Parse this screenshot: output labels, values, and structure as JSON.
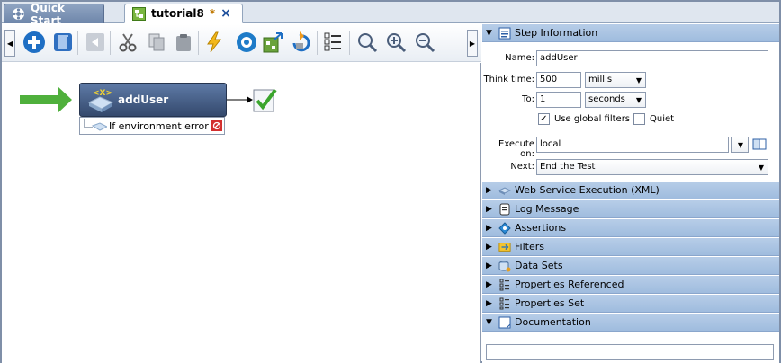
{
  "tabs": [
    {
      "label": "Quick Start",
      "icon": "gear-flower-icon"
    },
    {
      "label": "tutorial8",
      "icon": "test-case-icon",
      "dirty": "*",
      "close": "×"
    }
  ],
  "toolbar": {
    "buttons": [
      "add-icon",
      "delete-icon",
      "back-icon",
      "cut-icon",
      "copy-icon",
      "paste-icon",
      "lightning-icon",
      "settings-icon",
      "export-icon",
      "refresh-icon",
      "properties-icon",
      "zoom-icon",
      "zoom-in-icon",
      "zoom-out-icon"
    ]
  },
  "canvas": {
    "step_name": "addUser",
    "handler_label": "If environment error"
  },
  "panel": {
    "step_info_title": "Step Information",
    "name_label": "Name:",
    "name_value": "addUser",
    "think_time_label": "Think time:",
    "think_time_value": "500",
    "think_time_unit": "millis",
    "to_label": "To:",
    "to_value": "1",
    "to_unit": "seconds",
    "global_filters_label": "Use global filters",
    "global_filters_checked": "✓",
    "quiet_label": "Quiet",
    "execute_on_label": "Execute on:",
    "execute_on_value": "local",
    "next_label": "Next:",
    "next_value": "End the Test",
    "sections": [
      "Web Service Execution (XML)",
      "Log Message",
      "Assertions",
      "Filters",
      "Data Sets",
      "Properties Referenced",
      "Properties Set"
    ],
    "documentation_title": "Documentation"
  },
  "colors": {
    "section_header": "#a9c4e4",
    "step_fill": "#4a6490",
    "accent_green": "#4caf30"
  }
}
